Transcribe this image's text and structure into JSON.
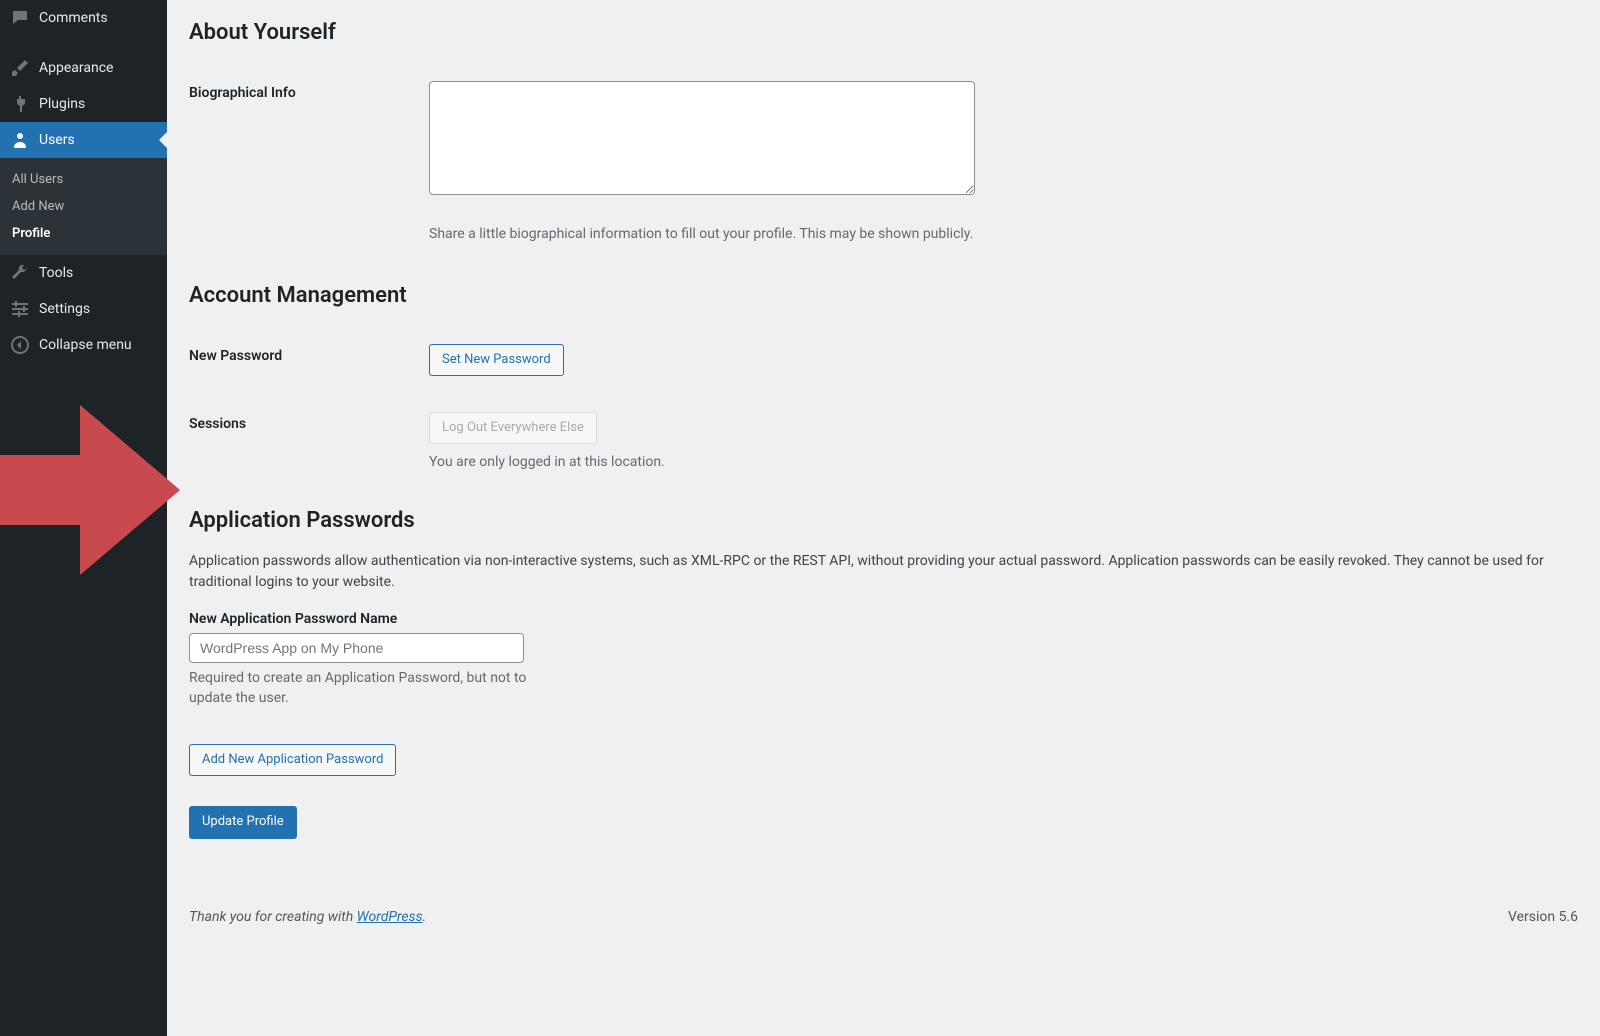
{
  "sidebar": {
    "items": [
      {
        "label": "Comments",
        "icon": "comment"
      },
      {
        "label": "Appearance",
        "icon": "brush"
      },
      {
        "label": "Plugins",
        "icon": "plugin"
      },
      {
        "label": "Users",
        "icon": "user",
        "active": true
      },
      {
        "label": "Tools",
        "icon": "wrench"
      },
      {
        "label": "Settings",
        "icon": "sliders"
      }
    ],
    "submenu": [
      {
        "label": "All Users"
      },
      {
        "label": "Add New"
      },
      {
        "label": "Profile",
        "current": true
      }
    ],
    "collapse_label": "Collapse menu"
  },
  "about": {
    "heading": "About Yourself",
    "bio_label": "Biographical Info",
    "bio_value": "",
    "bio_description": "Share a little biographical information to fill out your profile. This may be shown publicly."
  },
  "account": {
    "heading": "Account Management",
    "new_password_label": "New Password",
    "set_new_password_button": "Set New Password",
    "sessions_label": "Sessions",
    "logout_button": "Log Out Everywhere Else",
    "sessions_description": "You are only logged in at this location."
  },
  "app_passwords": {
    "heading": "Application Passwords",
    "description": "Application passwords allow authentication via non-interactive systems, such as XML-RPC or the REST API, without providing your actual password. Application passwords can be easily revoked. They cannot be used for traditional logins to your website.",
    "name_label": "New Application Password Name",
    "name_placeholder": "WordPress App on My Phone",
    "name_help": "Required to create an Application Password, but not to update the user.",
    "add_button": "Add New Application Password"
  },
  "update_button": "Update Profile",
  "footer": {
    "thank_you_prefix": "Thank you for creating with ",
    "wordpress_link": "WordPress",
    "thank_you_suffix": ".",
    "version": "Version 5.6"
  }
}
